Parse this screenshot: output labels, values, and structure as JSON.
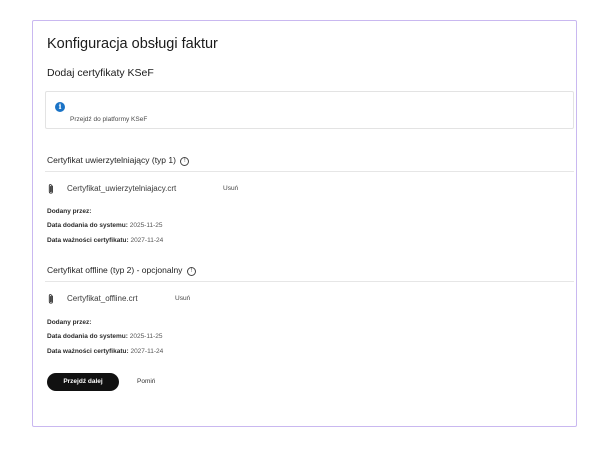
{
  "page": {
    "title": "Konfiguracja obsługi faktur",
    "subtitle": "Dodaj certyfikaty KSeF"
  },
  "info": {
    "icon": "info-icon",
    "link_text": "Przejdź do platformy KSeF"
  },
  "certificates": [
    {
      "section_title": "Certyfikat uwierzytelniający (typ 1)",
      "file_name": "Certyfikat_uwierzytelniajacy.crt",
      "remove_label": "Usuń",
      "added_by_label": "Dodany przez:",
      "added_by_value": "",
      "date_added_label": "Data dodania do systemu:",
      "date_added_value": "2025-11-25",
      "expiry_label": "Data ważności certyfikatu:",
      "expiry_value": "2027-11-24"
    },
    {
      "section_title": "Certyfikat offline (typ 2) - opcjonalny",
      "file_name": "Certyfikat_offline.crt",
      "remove_label": "Usuń",
      "added_by_label": "Dodany przez:",
      "added_by_value": "",
      "date_added_label": "Data dodania do systemu:",
      "date_added_value": "2025-11-25",
      "expiry_label": "Data ważności certyfikatu:",
      "expiry_value": "2027-11-24"
    }
  ],
  "actions": {
    "next_label": "Przejdź dalej",
    "skip_label": "Pomiń"
  },
  "colors": {
    "card_border": "#c9b8f0",
    "info_icon": "#1a73c6",
    "primary_button": "#111111"
  },
  "icons": {
    "help": "help-circle-icon",
    "attachment": "paperclip-icon"
  }
}
